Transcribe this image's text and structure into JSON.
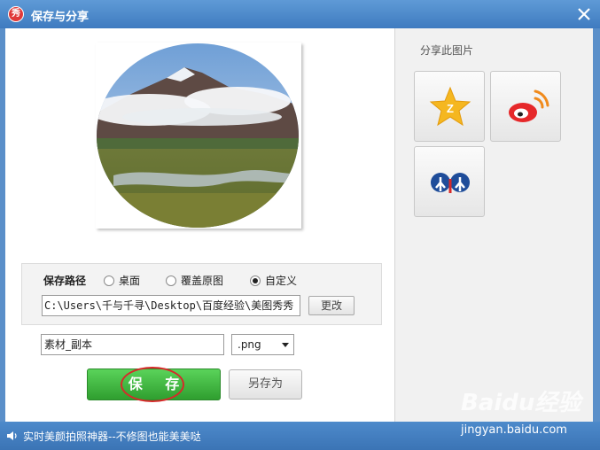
{
  "window": {
    "title": "保存与分享",
    "app_icon_char": "秀"
  },
  "save_path": {
    "label": "保存路径",
    "options": [
      {
        "label": "桌面",
        "selected": false
      },
      {
        "label": "覆盖原图",
        "selected": false
      },
      {
        "label": "自定义",
        "selected": true
      }
    ],
    "path_value": "C:\\Users\\千与千寻\\Desktop\\百度经验\\美图秀秀",
    "change_label": "更改"
  },
  "file": {
    "name": "素材_副本",
    "format": ".png"
  },
  "buttons": {
    "save": "保 存",
    "save_as": "另存为"
  },
  "share": {
    "title": "分享此图片",
    "targets": [
      {
        "icon": "qzone-star-icon"
      },
      {
        "icon": "weibo-icon"
      },
      {
        "icon": "renren-icon"
      }
    ]
  },
  "status": {
    "text": "实时美颜拍照神器--不修图也能美美哒"
  },
  "watermark": {
    "logo": "Baidu经验",
    "url": "jingyan.baidu.com"
  },
  "colors": {
    "titlebar": "#4a86c8",
    "save_green": "#3fb33f",
    "annotation_red": "#d62a2a"
  }
}
